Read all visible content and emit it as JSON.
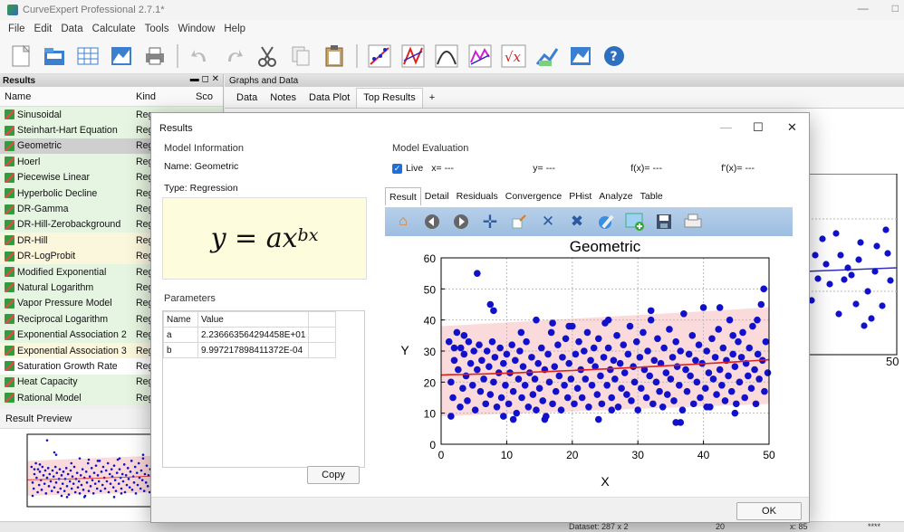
{
  "app": {
    "title": "CurveExpert Professional 2.7.1*",
    "window_controls": [
      "—",
      "□"
    ]
  },
  "menu": [
    "File",
    "Edit",
    "Data",
    "Calculate",
    "Tools",
    "Window",
    "Help"
  ],
  "toolbar_icons": [
    "new-document-icon",
    "open-folder-icon",
    "spreadsheet-icon",
    "plot-icon",
    "print-icon",
    "undo-icon",
    "redo-icon",
    "cut-icon",
    "copy-icon",
    "paste-icon",
    "curve-fit-icon",
    "curve-fit-multi-icon",
    "polynomial-icon",
    "nonparametric-icon",
    "sqrt-function-icon",
    "chart-line-icon",
    "chart-area-icon",
    "help-icon"
  ],
  "results_panel": {
    "title": "Results",
    "controls": "▬ ◻ ✕",
    "columns": {
      "name": "Name",
      "kind": "Kind",
      "score": "Sco"
    },
    "rows": [
      {
        "name": "Sinusoidal",
        "kind": "Reg",
        "color": "g"
      },
      {
        "name": "Steinhart-Hart Equation",
        "kind": "Reg",
        "color": "g"
      },
      {
        "name": "Geometric",
        "kind": "Reg",
        "color": "s"
      },
      {
        "name": "Hoerl",
        "kind": "Reg",
        "color": "g"
      },
      {
        "name": "Piecewise Linear",
        "kind": "Reg",
        "color": "g"
      },
      {
        "name": "Hyperbolic Decline",
        "kind": "Reg",
        "color": "g"
      },
      {
        "name": "DR-Gamma",
        "kind": "Reg",
        "color": "g"
      },
      {
        "name": "DR-Hill-Zerobackground",
        "kind": "Reg",
        "color": "g"
      },
      {
        "name": "DR-Hill",
        "kind": "Reg",
        "color": "y"
      },
      {
        "name": "DR-LogProbit",
        "kind": "Reg",
        "color": "y"
      },
      {
        "name": "Modified Exponential",
        "kind": "Reg",
        "color": "g"
      },
      {
        "name": "Natural Logarithm",
        "kind": "Reg",
        "color": "g"
      },
      {
        "name": "Vapor Pressure Model",
        "kind": "Reg",
        "color": "g"
      },
      {
        "name": "Reciprocal Logarithm",
        "kind": "Reg",
        "color": "g"
      },
      {
        "name": "Exponential Association 2",
        "kind": "Reg",
        "color": "g"
      },
      {
        "name": "Exponential Association 3",
        "kind": "Reg",
        "color": "y"
      },
      {
        "name": "Saturation Growth Rate",
        "kind": "Reg",
        "color": "w"
      },
      {
        "name": "Heat Capacity",
        "kind": "Reg",
        "color": "g"
      },
      {
        "name": "Rational Model",
        "kind": "Reg",
        "color": "g"
      }
    ]
  },
  "preview_panel": {
    "title": "Result Preview"
  },
  "graphs_panel": {
    "title": "Graphs and Data",
    "tabs": [
      "Data",
      "Notes",
      "Data Plot",
      "Top Results",
      "+"
    ],
    "active_tab": "Top Results",
    "axis_edge_label": "50"
  },
  "statusbar": {
    "dataset": "Dataset: 287 x 2",
    "zoom": "20",
    "field": "x: 85",
    "extra": "****"
  },
  "dialog": {
    "title": "Results",
    "window_controls": [
      "—",
      "☐",
      "✕"
    ],
    "model_info": {
      "section": "Model Information",
      "name_label": "Name:",
      "name_value": "Geometric",
      "type_label": "Type:",
      "type_value": "Regression",
      "equation": {
        "lhs": "y",
        "eq": " = ",
        "a": "a",
        "x": "x",
        "exp": "bx"
      }
    },
    "parameters": {
      "section": "Parameters",
      "columns": [
        "Name",
        "Value"
      ],
      "rows": [
        {
          "name": "a",
          "value": "2.236663564294458E+01"
        },
        {
          "name": "b",
          "value": "9.997217898411372E-04"
        }
      ],
      "copy_label": "Copy"
    },
    "evaluation": {
      "section": "Model Evaluation",
      "live_label": "Live",
      "fields": [
        "x= ---",
        "y= ---",
        "f(x)= ---",
        "f'(x)= ---"
      ]
    },
    "result_tabs": [
      "Result",
      "Detail",
      "Residuals",
      "Convergence",
      "PHist",
      "Analyze",
      "Table"
    ],
    "active_result_tab": "Result",
    "plot_toolbar_icons": [
      "home-icon",
      "back-icon",
      "forward-icon",
      "pan-icon",
      "zoom-rect-icon",
      "fit-expand-icon",
      "fit-shrink-icon",
      "settings-icon",
      "add-plot-icon",
      "save-icon",
      "print-icon"
    ],
    "ok_label": "OK"
  },
  "chart_data": {
    "type": "scatter",
    "title": "Geometric",
    "xlabel": "X",
    "ylabel": "Y",
    "xlim": [
      0,
      50
    ],
    "ylim": [
      0,
      60
    ],
    "xticks": [
      0,
      10,
      20,
      30,
      40,
      50
    ],
    "yticks": [
      0,
      10,
      20,
      30,
      40,
      50,
      60
    ],
    "grid": true,
    "colors": {
      "points": "#1111cc",
      "fit": "#e02020",
      "band": "#f9d6d6"
    },
    "fit": {
      "a": 22.36663564294458,
      "b": 0.0009997217898411372
    },
    "band": {
      "x": [
        0,
        50
      ],
      "lower": [
        9,
        13
      ],
      "upper": [
        38,
        44
      ]
    },
    "points": [
      [
        1.2,
        33
      ],
      [
        1.5,
        20
      ],
      [
        1.8,
        15
      ],
      [
        2.0,
        27
      ],
      [
        2.4,
        36
      ],
      [
        2.6,
        24
      ],
      [
        2.9,
        12
      ],
      [
        3.0,
        31
      ],
      [
        3.3,
        18
      ],
      [
        3.5,
        29
      ],
      [
        3.8,
        22
      ],
      [
        4.0,
        14
      ],
      [
        4.2,
        33
      ],
      [
        4.5,
        26
      ],
      [
        4.8,
        19
      ],
      [
        5.0,
        30
      ],
      [
        5.2,
        11
      ],
      [
        5.5,
        24
      ],
      [
        5.8,
        32
      ],
      [
        6.0,
        17
      ],
      [
        6.2,
        27
      ],
      [
        6.5,
        21
      ],
      [
        6.8,
        13
      ],
      [
        7.0,
        30
      ],
      [
        7.3,
        25
      ],
      [
        7.5,
        16
      ],
      [
        7.8,
        33
      ],
      [
        8.0,
        20
      ],
      [
        8.2,
        28
      ],
      [
        8.5,
        12
      ],
      [
        8.8,
        23
      ],
      [
        9.0,
        31
      ],
      [
        9.2,
        15
      ],
      [
        9.5,
        26
      ],
      [
        9.8,
        19
      ],
      [
        10.0,
        29
      ],
      [
        10.3,
        13
      ],
      [
        10.5,
        23
      ],
      [
        10.8,
        32
      ],
      [
        11.0,
        17
      ],
      [
        11.3,
        27
      ],
      [
        11.5,
        10
      ],
      [
        11.8,
        21
      ],
      [
        12.0,
        30
      ],
      [
        12.3,
        15
      ],
      [
        12.5,
        25
      ],
      [
        12.8,
        19
      ],
      [
        13.0,
        33
      ],
      [
        13.3,
        12
      ],
      [
        13.5,
        23
      ],
      [
        13.8,
        28
      ],
      [
        14.0,
        16
      ],
      [
        14.3,
        21
      ],
      [
        14.5,
        11
      ],
      [
        14.8,
        26
      ],
      [
        15.0,
        18
      ],
      [
        15.3,
        31
      ],
      [
        15.5,
        14
      ],
      [
        15.8,
        24
      ],
      [
        16.0,
        9
      ],
      [
        16.3,
        29
      ],
      [
        16.5,
        20
      ],
      [
        16.8,
        36
      ],
      [
        17.0,
        13
      ],
      [
        17.3,
        25
      ],
      [
        17.5,
        17
      ],
      [
        17.8,
        32
      ],
      [
        18.0,
        22
      ],
      [
        18.3,
        11
      ],
      [
        18.5,
        28
      ],
      [
        18.8,
        19
      ],
      [
        19.0,
        34
      ],
      [
        19.3,
        15
      ],
      [
        19.5,
        26
      ],
      [
        19.8,
        21
      ],
      [
        20.0,
        38
      ],
      [
        20.3,
        13
      ],
      [
        20.5,
        29
      ],
      [
        20.8,
        18
      ],
      [
        21.0,
        33
      ],
      [
        21.3,
        24
      ],
      [
        21.5,
        15
      ],
      [
        21.8,
        30
      ],
      [
        22.0,
        21
      ],
      [
        22.3,
        36
      ],
      [
        22.5,
        12
      ],
      [
        22.8,
        27
      ],
      [
        23.0,
        19
      ],
      [
        23.3,
        31
      ],
      [
        23.5,
        25
      ],
      [
        23.8,
        16
      ],
      [
        24.0,
        34
      ],
      [
        24.3,
        22
      ],
      [
        24.5,
        13
      ],
      [
        24.8,
        28
      ],
      [
        25.0,
        39
      ],
      [
        25.3,
        19
      ],
      [
        25.5,
        31
      ],
      [
        25.8,
        24
      ],
      [
        26.0,
        15
      ],
      [
        26.3,
        27
      ],
      [
        26.5,
        21
      ],
      [
        26.8,
        35
      ],
      [
        27.0,
        12
      ],
      [
        27.3,
        26
      ],
      [
        27.5,
        18
      ],
      [
        27.8,
        32
      ],
      [
        28.0,
        23
      ],
      [
        28.3,
        16
      ],
      [
        28.5,
        29
      ],
      [
        28.8,
        38
      ],
      [
        29.0,
        14
      ],
      [
        29.3,
        25
      ],
      [
        29.5,
        20
      ],
      [
        29.8,
        33
      ],
      [
        30.0,
        11
      ],
      [
        30.3,
        28
      ],
      [
        30.5,
        18
      ],
      [
        30.8,
        36
      ],
      [
        31.0,
        24
      ],
      [
        31.3,
        15
      ],
      [
        31.5,
        30
      ],
      [
        31.8,
        22
      ],
      [
        32.0,
        40
      ],
      [
        32.3,
        13
      ],
      [
        32.5,
        27
      ],
      [
        32.8,
        20
      ],
      [
        33.0,
        34
      ],
      [
        33.3,
        17
      ],
      [
        33.5,
        26
      ],
      [
        33.8,
        12
      ],
      [
        34.0,
        31
      ],
      [
        34.3,
        23
      ],
      [
        34.5,
        16
      ],
      [
        34.8,
        37
      ],
      [
        35.0,
        21
      ],
      [
        35.3,
        28
      ],
      [
        35.5,
        14
      ],
      [
        35.8,
        33
      ],
      [
        36.0,
        25
      ],
      [
        36.3,
        19
      ],
      [
        36.5,
        30
      ],
      [
        36.8,
        11
      ],
      [
        37.0,
        42
      ],
      [
        37.3,
        24
      ],
      [
        37.5,
        17
      ],
      [
        37.8,
        29
      ],
      [
        38.0,
        22
      ],
      [
        38.3,
        35
      ],
      [
        38.5,
        13
      ],
      [
        38.8,
        27
      ],
      [
        39.0,
        20
      ],
      [
        39.3,
        32
      ],
      [
        39.5,
        15
      ],
      [
        39.8,
        26
      ],
      [
        40.0,
        44
      ],
      [
        40.3,
        18
      ],
      [
        40.5,
        30
      ],
      [
        40.8,
        23
      ],
      [
        41.0,
        12
      ],
      [
        41.3,
        34
      ],
      [
        41.5,
        21
      ],
      [
        41.8,
        28
      ],
      [
        42.0,
        16
      ],
      [
        42.3,
        37
      ],
      [
        42.5,
        24
      ],
      [
        42.8,
        19
      ],
      [
        43.0,
        31
      ],
      [
        43.3,
        14
      ],
      [
        43.5,
        27
      ],
      [
        43.8,
        22
      ],
      [
        44.0,
        40
      ],
      [
        44.3,
        17
      ],
      [
        44.5,
        29
      ],
      [
        44.8,
        25
      ],
      [
        45.0,
        13
      ],
      [
        45.3,
        33
      ],
      [
        45.5,
        20
      ],
      [
        45.8,
        28
      ],
      [
        46.0,
        36
      ],
      [
        46.3,
        15
      ],
      [
        46.5,
        26
      ],
      [
        46.8,
        22
      ],
      [
        47.0,
        31
      ],
      [
        47.3,
        18
      ],
      [
        47.5,
        38
      ],
      [
        47.8,
        24
      ],
      [
        48.0,
        13
      ],
      [
        48.3,
        29
      ],
      [
        48.5,
        21
      ],
      [
        48.8,
        45
      ],
      [
        49.0,
        27
      ],
      [
        49.3,
        17
      ],
      [
        49.5,
        33
      ],
      [
        49.8,
        23
      ],
      [
        49.2,
        50
      ],
      [
        5.5,
        55
      ],
      [
        7.5,
        45
      ],
      [
        8.0,
        43
      ],
      [
        32.0,
        43
      ],
      [
        42.5,
        44
      ],
      [
        48.2,
        40
      ],
      [
        44.5,
        35
      ],
      [
        25.5,
        40
      ],
      [
        19.5,
        38
      ],
      [
        14.5,
        40
      ],
      [
        3.5,
        35
      ],
      [
        2.0,
        31
      ],
      [
        12.2,
        36
      ],
      [
        17.0,
        39
      ],
      [
        36.5,
        7
      ],
      [
        11.0,
        8
      ],
      [
        9.5,
        9
      ],
      [
        35.8,
        7
      ],
      [
        24.0,
        8
      ],
      [
        44.8,
        10
      ],
      [
        1.5,
        9
      ],
      [
        15.8,
        8
      ],
      [
        26.0,
        11
      ],
      [
        40.5,
        12
      ]
    ]
  }
}
